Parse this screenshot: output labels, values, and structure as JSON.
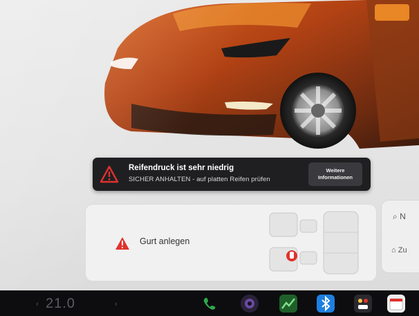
{
  "alert": {
    "title": "Reifendruck ist sehr niedrig",
    "subtitle": "SICHER ANHALTEN - auf platten Reifen prüfen",
    "more_button_line1": "Weitere",
    "more_button_line2": "Informationen",
    "icon": "warning-triangle-icon",
    "accent": "#e0322d"
  },
  "seatbelt_card": {
    "label": "Gurt anlegen",
    "icon": "warning-triangle-icon",
    "accent": "#e0322d"
  },
  "side_panel": {
    "search_label": "N",
    "nav_label": "Zu"
  },
  "taskbar": {
    "temperature": "21.0",
    "icons": [
      "phone-icon",
      "camera-icon",
      "energy-chart-icon",
      "bluetooth-icon",
      "app-launcher-icon",
      "calendar-icon"
    ],
    "colors": {
      "phone": "#2ea84a",
      "camera": "#3a2a55",
      "chart": "#2a8c3a",
      "bluetooth": "#1e7fe0"
    }
  }
}
